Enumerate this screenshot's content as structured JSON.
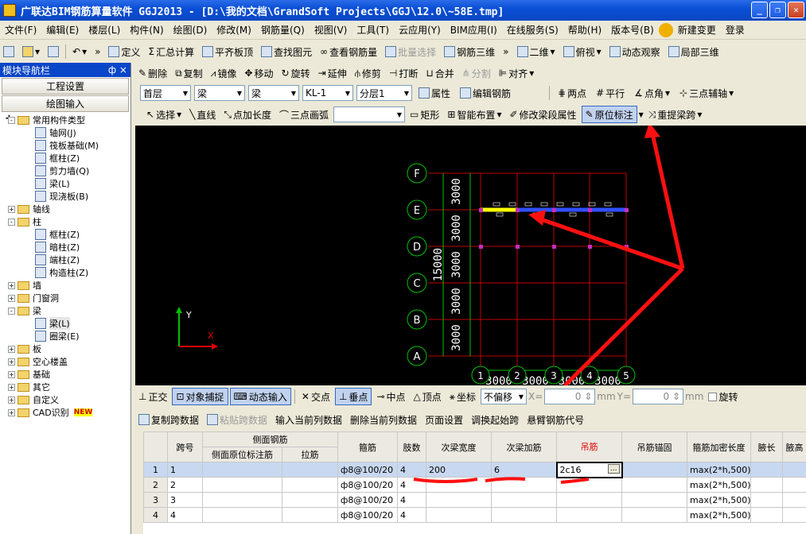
{
  "window": {
    "title": "广联达BIM钢筋算量软件 GGJ2013 - [D:\\我的文档\\GrandSoft Projects\\GGJ\\12.0\\~58E.tmp]"
  },
  "menu": [
    "文件(F)",
    "编辑(E)",
    "楼层(L)",
    "构件(N)",
    "绘图(D)",
    "修改(M)",
    "钢筋量(Q)",
    "视图(V)",
    "工具(T)",
    "云应用(Y)",
    "BIM应用(I)",
    "在线服务(S)",
    "帮助(H)",
    "版本号(B)",
    "新建变更",
    "登录"
  ],
  "toolbar1": {
    "define": "定义",
    "summary": "汇总计算",
    "flat": "平齐板顶",
    "find": "查找图元",
    "view_rebar": "查看钢筋量",
    "batch": "批量选择",
    "rebar3d": "钢筋三维",
    "view2d": "二维",
    "topview": "俯视",
    "dynamic": "动态观察",
    "local3d": "局部三维"
  },
  "toolbar2": {
    "delete": "删除",
    "copy": "复制",
    "mirror": "镜像",
    "move": "移动",
    "rotate": "旋转",
    "extend": "延伸",
    "trim": "修剪",
    "break": "打断",
    "merge": "合并",
    "split": "分割",
    "align": "对齐"
  },
  "toolbar3": {
    "floor": "首层",
    "category": "梁",
    "type": "梁",
    "element": "KL-1",
    "layer": "分层1",
    "property": "属性",
    "edit_rebar": "编辑钢筋",
    "two_point": "两点",
    "parallel": "平行",
    "point_angle": "点角",
    "three_axis": "三点辅轴"
  },
  "toolbar4": {
    "select": "选择",
    "line": "直线",
    "point_len": "点加长度",
    "arc": "三点画弧",
    "rect": "矩形",
    "smart": "智能布置",
    "modify_span": "修改梁段属性",
    "original": "原位标注",
    "pick": "重提梁跨"
  },
  "sidebar": {
    "title": "模块导航栏",
    "pin": "ф ×",
    "btn_engineering": "工程设置",
    "btn_drawing": "绘图输入",
    "tree": [
      {
        "label": "常用构件类型",
        "level": 0,
        "kind": "folder",
        "exp": "-"
      },
      {
        "label": "轴网(J)",
        "level": 1,
        "kind": "leaf"
      },
      {
        "label": "筏板基础(M)",
        "level": 1,
        "kind": "leaf"
      },
      {
        "label": "框柱(Z)",
        "level": 1,
        "kind": "leaf"
      },
      {
        "label": "剪力墙(Q)",
        "level": 1,
        "kind": "leaf"
      },
      {
        "label": "梁(L)",
        "level": 1,
        "kind": "leaf"
      },
      {
        "label": "现浇板(B)",
        "level": 1,
        "kind": "leaf"
      },
      {
        "label": "轴线",
        "level": 0,
        "kind": "folder",
        "exp": "+"
      },
      {
        "label": "柱",
        "level": 0,
        "kind": "folder",
        "exp": "-"
      },
      {
        "label": "框柱(Z)",
        "level": 1,
        "kind": "leaf"
      },
      {
        "label": "暗柱(Z)",
        "level": 1,
        "kind": "leaf"
      },
      {
        "label": "端柱(Z)",
        "level": 1,
        "kind": "leaf"
      },
      {
        "label": "构造柱(Z)",
        "level": 1,
        "kind": "leaf"
      },
      {
        "label": "墙",
        "level": 0,
        "kind": "folder",
        "exp": "+"
      },
      {
        "label": "门窗洞",
        "level": 0,
        "kind": "folder",
        "exp": "+"
      },
      {
        "label": "梁",
        "level": 0,
        "kind": "folder",
        "exp": "-"
      },
      {
        "label": "梁(L)",
        "level": 1,
        "kind": "leaf"
      },
      {
        "label": "圈梁(E)",
        "level": 1,
        "kind": "leaf"
      },
      {
        "label": "板",
        "level": 0,
        "kind": "folder",
        "exp": "+"
      },
      {
        "label": "空心楼盖",
        "level": 0,
        "kind": "folder",
        "exp": "+"
      },
      {
        "label": "基础",
        "level": 0,
        "kind": "folder",
        "exp": "+"
      },
      {
        "label": "其它",
        "level": 0,
        "kind": "folder",
        "exp": "+"
      },
      {
        "label": "自定义",
        "level": 0,
        "kind": "folder",
        "exp": "+"
      },
      {
        "label": "CAD识别",
        "level": 0,
        "kind": "folder",
        "exp": "+"
      }
    ],
    "new_badge": "NEW"
  },
  "canvas": {
    "row_axes": [
      "F",
      "E",
      "D",
      "C",
      "B",
      "A"
    ],
    "col_axes": [
      "1",
      "2",
      "3",
      "4",
      "5"
    ],
    "row_dims": [
      "3000",
      "3000",
      "3000",
      "3000",
      "3000"
    ],
    "row_total": "15000",
    "col_dims": [
      "3000",
      "3000",
      "3000",
      "3000"
    ],
    "ucs_y": "Y",
    "ucs_x": "X"
  },
  "snapbar": {
    "ortho": "正交",
    "snap": "对象捕捉",
    "dyn": "动态输入",
    "intersect": "交点",
    "perp": "垂点",
    "mid": "中点",
    "vertex": "顶点",
    "coord": "坐标",
    "offset": "不偏移",
    "x_label": "X=",
    "x_val": "0",
    "y_label": "Y=",
    "y_val": "0",
    "unit": "mm",
    "rotate": "旋转"
  },
  "gridbar": [
    "复制跨数据",
    "粘贴跨数据",
    "输入当前列数据",
    "删除当前列数据",
    "页面设置",
    "调换起始跨",
    "悬臂钢筋代号"
  ],
  "table": {
    "headers": [
      "跨号",
      "侧面钢筋",
      "侧面原位标注筋",
      "拉筋",
      "箍筋",
      "肢数",
      "次梁宽度",
      "次梁加筋",
      "吊筋",
      "吊筋锚固",
      "箍筋加密长度",
      "腋长",
      "腋高"
    ],
    "rows": [
      {
        "num": "1",
        "span": "1",
        "stirrup": "ф8@100/20",
        "legs": "4",
        "beam_w": "200",
        "add": "6",
        "hang": "2c16",
        "dense": "max(2*h,500)"
      },
      {
        "num": "2",
        "span": "2",
        "stirrup": "ф8@100/20",
        "legs": "4",
        "beam_w": "",
        "add": "",
        "hang": "",
        "dense": "max(2*h,500)"
      },
      {
        "num": "3",
        "span": "3",
        "stirrup": "ф8@100/20",
        "legs": "4",
        "beam_w": "",
        "add": "",
        "hang": "",
        "dense": "max(2*h,500)"
      },
      {
        "num": "4",
        "span": "4",
        "stirrup": "ф8@100/20",
        "legs": "4",
        "beam_w": "",
        "add": "",
        "hang": "",
        "dense": "max(2*h,500)"
      }
    ],
    "ellipsis": "..."
  },
  "colors": {
    "title": "#0a4fd6",
    "grid_line": "#c00000",
    "axis_green": "#00c000",
    "annotation": "#e00000"
  }
}
